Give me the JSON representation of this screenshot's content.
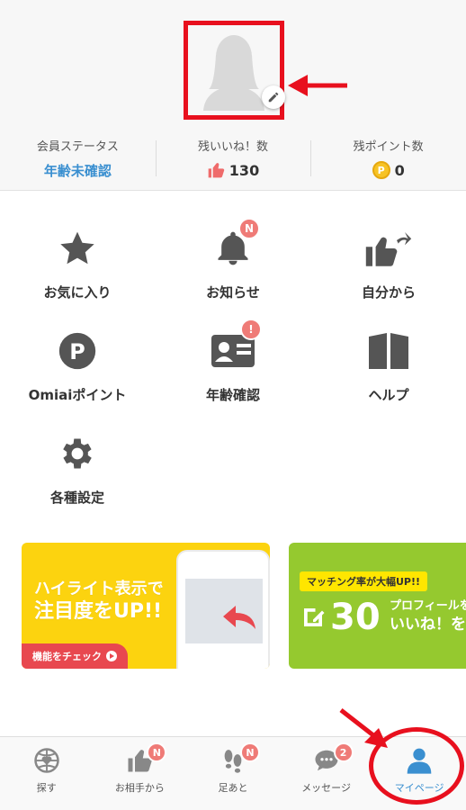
{
  "stats": [
    {
      "label": "会員ステータス",
      "value": "年齢未確認",
      "icon": ""
    },
    {
      "label": "残いいね！数",
      "value": "130",
      "icon": "thumbs-up-icon"
    },
    {
      "label": "残ポイント数",
      "value": "0",
      "icon": "coin-icon"
    }
  ],
  "coin_symbol": "P",
  "menu": [
    {
      "label": "お気に入り",
      "icon": "star-icon"
    },
    {
      "label": "お知らせ",
      "icon": "bell-icon",
      "badge": "N"
    },
    {
      "label": "自分から",
      "icon": "thumbs-up-share-icon"
    },
    {
      "label": "Omiaiポイント",
      "icon": "point-icon"
    },
    {
      "label": "年齢確認",
      "icon": "id-card-icon",
      "badge": "!"
    },
    {
      "label": "ヘルプ",
      "icon": "book-icon"
    },
    {
      "label": "各種設定",
      "icon": "gear-icon"
    }
  ],
  "banners": {
    "highlight": {
      "line1": "ハイライト表示で",
      "line2": "注目度をUP!!",
      "cta": "機能をチェック"
    },
    "matching": {
      "pill": "マッチング率が大幅UP!!",
      "big": "30",
      "small1": "プロフィールを",
      "small2": "いいね！を"
    }
  },
  "tabs": [
    {
      "label": "探す",
      "icon": "globe-heart-icon",
      "badge": ""
    },
    {
      "label": "お相手から",
      "icon": "thumbs-up-icon",
      "badge": "N"
    },
    {
      "label": "足あと",
      "icon": "footprints-icon",
      "badge": "N"
    },
    {
      "label": "メッセージ",
      "icon": "chat-bubble-icon",
      "badge": "2"
    },
    {
      "label": "マイページ",
      "icon": "person-icon",
      "badge": "",
      "active": true
    }
  ],
  "colors": {
    "accent": "#3a8fd0",
    "badge": "#ef7b77",
    "annotation": "#e8101e",
    "icon_gray": "#555555"
  }
}
